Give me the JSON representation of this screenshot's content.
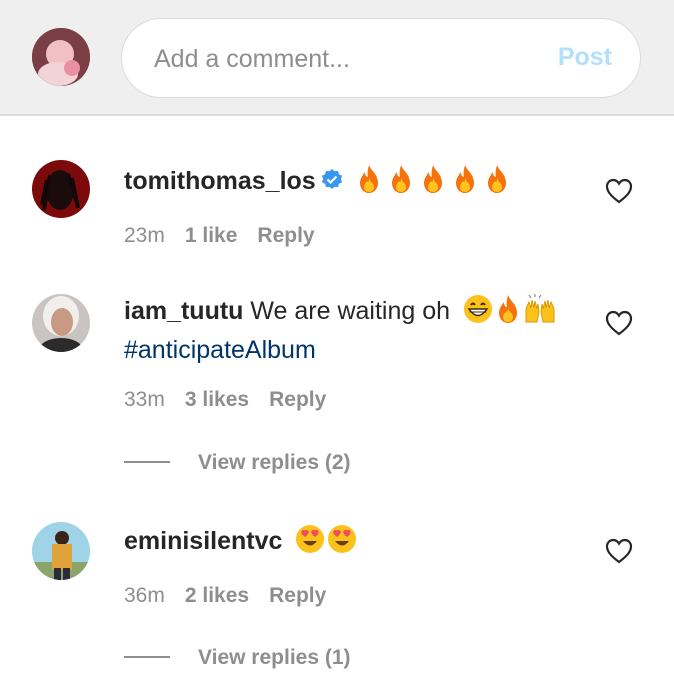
{
  "composer": {
    "placeholder": "Add a comment...",
    "post_label": "Post"
  },
  "comments": [
    {
      "username": "tomithomas_los",
      "verified": true,
      "text": "",
      "emojis": "fire x5",
      "time": "23m",
      "likes": "1 like",
      "reply": "Reply"
    },
    {
      "username": "iam_tuutu",
      "text": "We are waiting oh",
      "emojis": "grin, fire, raised-hands",
      "hashtag": "#anticipateAlbum",
      "time": "33m",
      "likes": "3 likes",
      "reply": "Reply",
      "view_replies": "View replies (2)"
    },
    {
      "username": "eminisilentvc",
      "text": "",
      "emojis": "heart-eyes x2",
      "time": "36m",
      "likes": "2 likes",
      "reply": "Reply",
      "view_replies": "View replies (1)"
    }
  ],
  "colors": {
    "top_bar": "#efefef",
    "post_disabled": "#b2dffc",
    "verified": "#3897f0",
    "hashtag": "#003569",
    "meta": "#8e8e8e"
  }
}
